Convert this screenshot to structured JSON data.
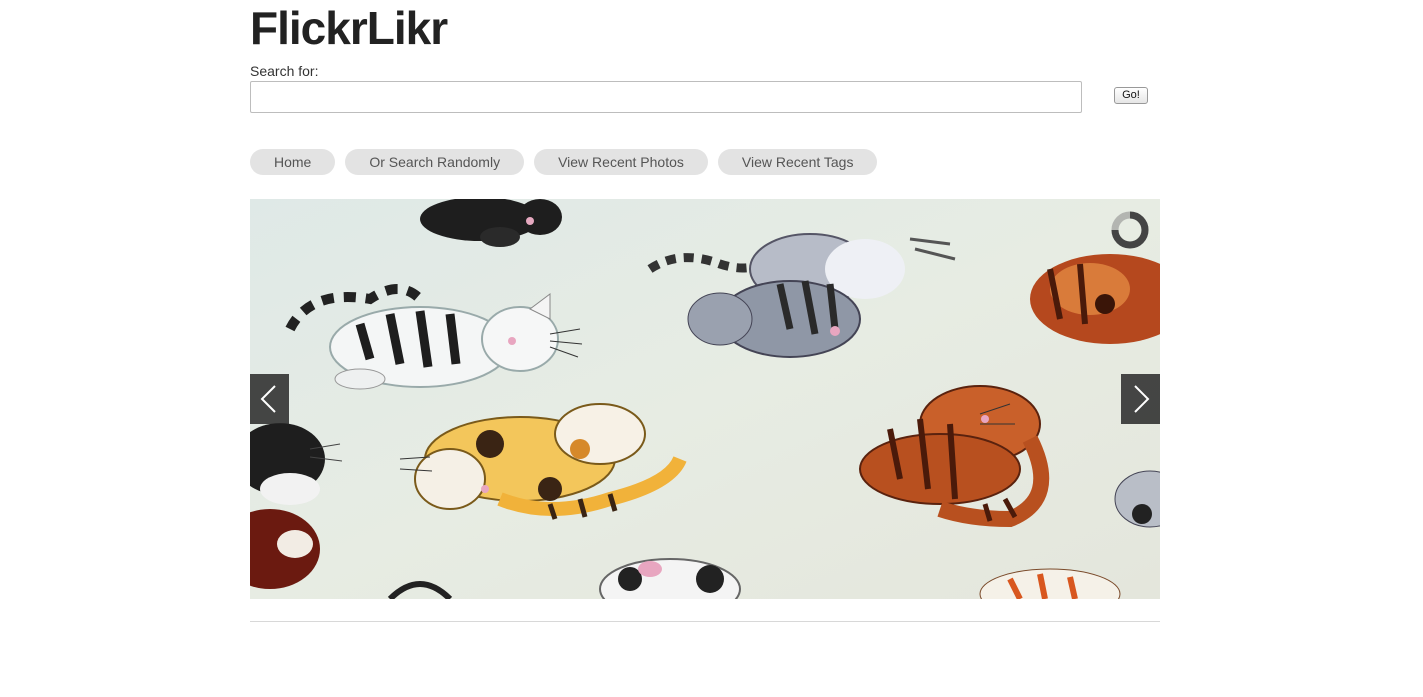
{
  "site": {
    "title": "FlickrLikr"
  },
  "search": {
    "label": "Search for:",
    "value": "",
    "placeholder": "",
    "button_label": "Go!"
  },
  "nav": {
    "items": [
      {
        "label": "Home"
      },
      {
        "label": "Or Search Randomly"
      },
      {
        "label": "View Recent Photos"
      },
      {
        "label": "View Recent Tags"
      }
    ]
  },
  "slideshow": {
    "photo_subject": "cartoon cats pattern fabric",
    "prev_icon": "chevron-left-icon",
    "next_icon": "chevron-right-icon",
    "loading_icon": "spinner-icon"
  },
  "colors": {
    "nav_pill_bg": "#e3e3e3",
    "photo_bg": "#dfe7e4",
    "arrow_bg": "#282828"
  }
}
